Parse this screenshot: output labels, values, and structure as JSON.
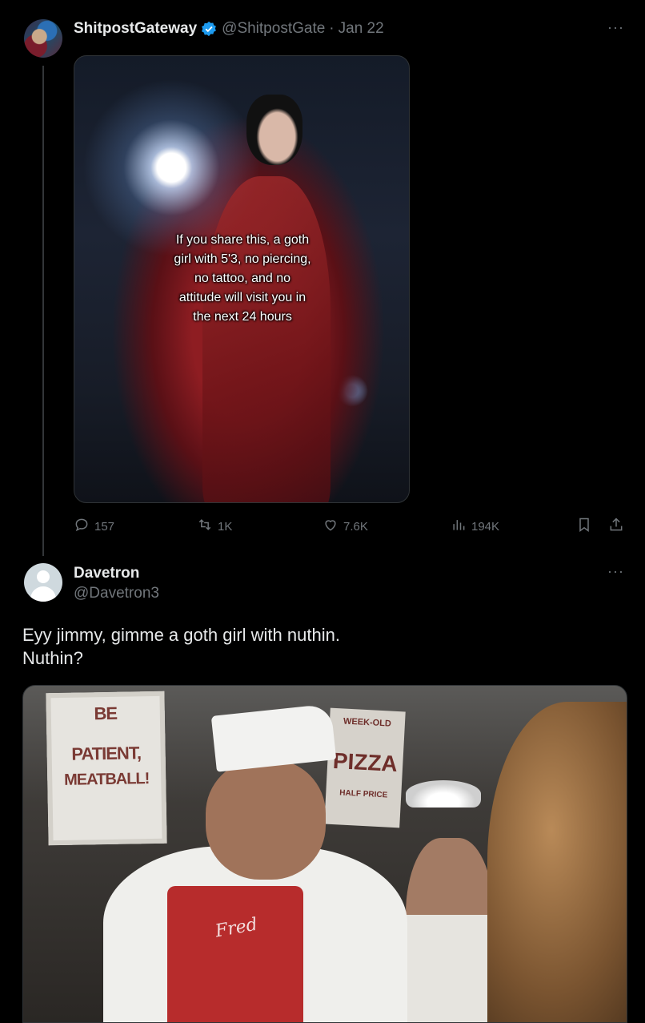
{
  "tweet": {
    "author": {
      "name": "ShitpostGateway",
      "handle": "@ShitpostGate",
      "verified": true
    },
    "separator": "·",
    "date": "Jan 22",
    "more_label": "···",
    "media": {
      "overlay_text": "If you share this, a goth\ngirl with 5'3, no piercing,\nno tattoo, and no\nattitude will visit you in\nthe next 24 hours"
    },
    "stats": {
      "replies": "157",
      "retweets": "1K",
      "likes": "7.6K",
      "views": "194K"
    }
  },
  "reply": {
    "author": {
      "name": "Davetron",
      "handle": "@Davetron3"
    },
    "more_label": "···",
    "text": "Eyy jimmy, gimme a goth girl with nuthin.\nNuthin?",
    "media": {
      "sign_left": [
        "BE",
        "PATIENT,",
        "MEATBALL!"
      ],
      "sign_right": [
        "WEEK-OLD",
        "PIZZA",
        "HALF PRICE"
      ],
      "apron_text": "Fred"
    }
  },
  "colors": {
    "background": "#000000",
    "text": "#e7e9ea",
    "muted": "#71767b",
    "verified": "#1d9bf0",
    "border": "#2f3336"
  }
}
